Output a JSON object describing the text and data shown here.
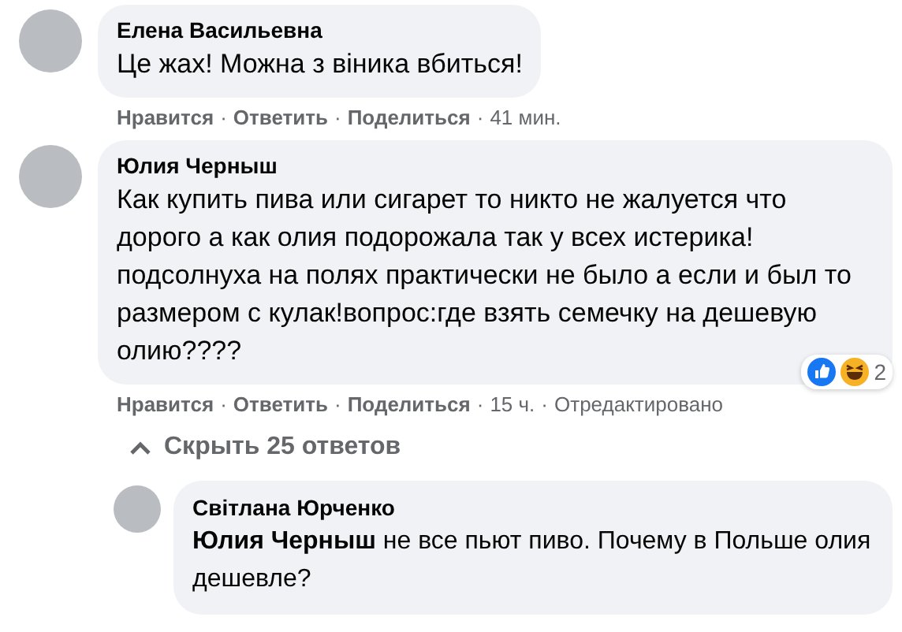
{
  "comments": [
    {
      "author": "Елена Васильевна",
      "text": "Це жах! Можна з віника вбиться!",
      "actions": [
        {
          "kind": "link",
          "label": "Нравится"
        },
        {
          "kind": "separator",
          "label": "·"
        },
        {
          "kind": "link",
          "label": "Ответить"
        },
        {
          "kind": "separator",
          "label": "·"
        },
        {
          "kind": "link",
          "label": "Поделиться"
        },
        {
          "kind": "separator",
          "label": "·"
        },
        {
          "kind": "meta",
          "label": "41 мин."
        }
      ]
    },
    {
      "author": "Юлия Черныш",
      "text": "Как купить пива или сигарет то никто не жалуется что дорого а как олия подорожала так у всех истерика! подсолнуха на полях практически не было а если и был то размером с кулак!вопрос:где взять семечку на дешевую олию????",
      "actions": [
        {
          "kind": "link",
          "label": "Нравится"
        },
        {
          "kind": "separator",
          "label": "·"
        },
        {
          "kind": "link",
          "label": "Ответить"
        },
        {
          "kind": "separator",
          "label": "·"
        },
        {
          "kind": "link",
          "label": "Поделиться"
        },
        {
          "kind": "separator",
          "label": "·"
        },
        {
          "kind": "meta",
          "label": "15 ч."
        },
        {
          "kind": "separator",
          "label": "·"
        },
        {
          "kind": "meta",
          "label": "Отредактировано"
        }
      ],
      "reactions": {
        "count": "2"
      },
      "replies_toggle": {
        "label": "Скрыть 25 ответов",
        "expanded": true
      },
      "replies": [
        {
          "author": "Світлана Юрченко",
          "text": "**Юлия Черныш** не все пьют пиво. Почему в Польше олия дешевле?"
        }
      ]
    }
  ]
}
